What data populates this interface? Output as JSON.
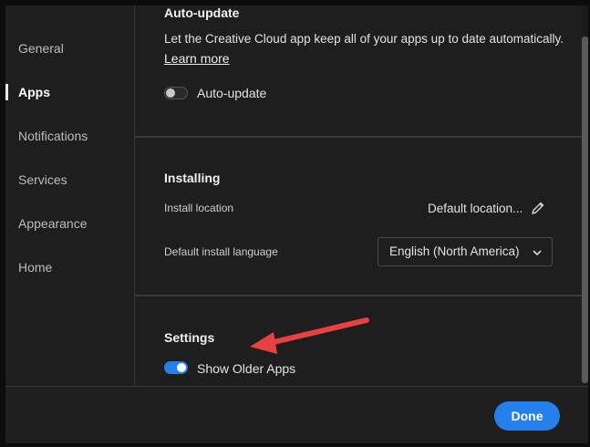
{
  "sidebar": {
    "items": [
      {
        "label": "General"
      },
      {
        "label": "Apps"
      },
      {
        "label": "Notifications"
      },
      {
        "label": "Services"
      },
      {
        "label": "Appearance"
      },
      {
        "label": "Home"
      }
    ],
    "active": "Apps"
  },
  "auto_update": {
    "title": "Auto-update",
    "description": "Let the Creative Cloud app keep all of your apps up to date automatically.",
    "learn_more": "Learn more",
    "toggle_label": "Auto-update",
    "toggle_on": false
  },
  "installing": {
    "title": "Installing",
    "location_label": "Install location",
    "location_value": "Default location...",
    "language_label": "Default install language",
    "language_value": "English (North America)"
  },
  "settings": {
    "title": "Settings",
    "toggle_label": "Show Older Apps",
    "toggle_on": true
  },
  "footer": {
    "done_label": "Done"
  },
  "colors": {
    "accent": "#2680eb",
    "annotation_arrow": "#e84142"
  },
  "icons": {
    "edit": "pencil-icon",
    "dropdown": "chevron-down-icon"
  }
}
